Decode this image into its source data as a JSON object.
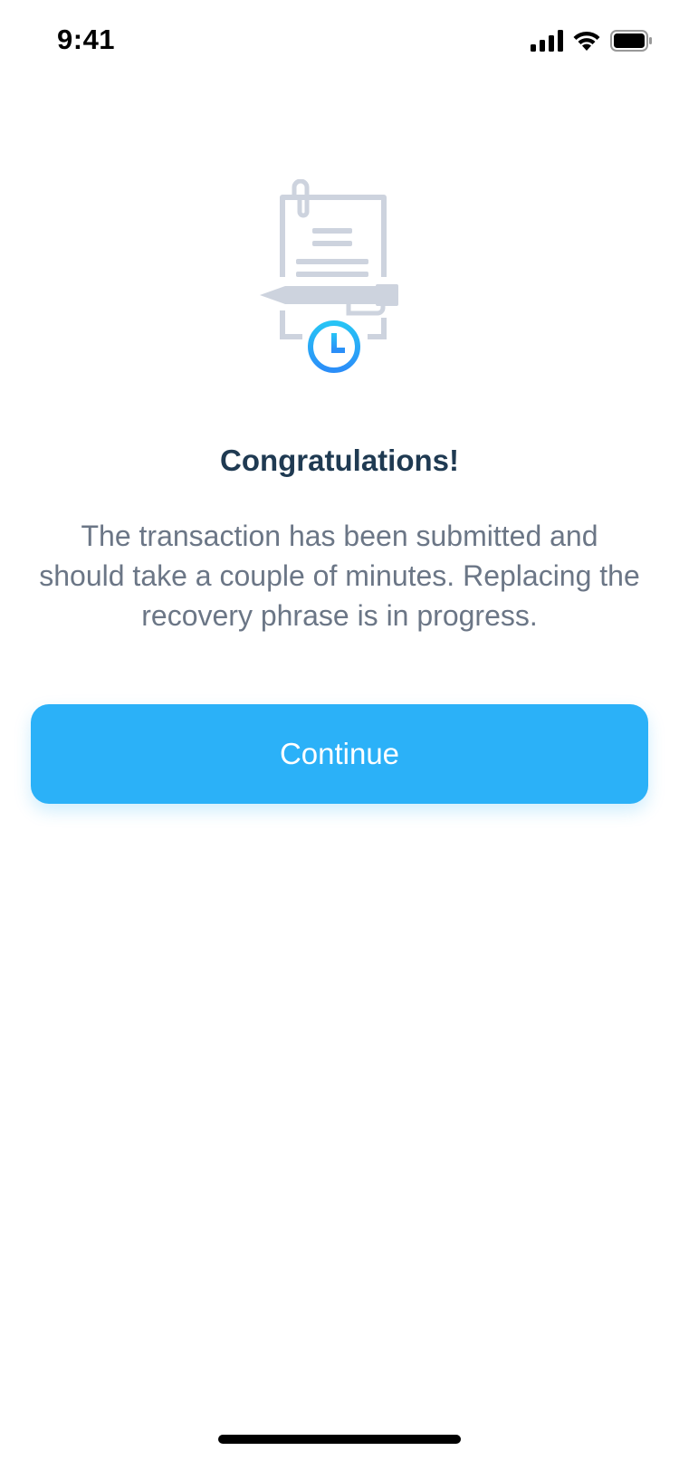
{
  "status_bar": {
    "time": "9:41",
    "icons": [
      "cellular-signal-icon",
      "wifi-icon",
      "battery-icon"
    ]
  },
  "illustration": {
    "icon": "document-pending-clock-icon",
    "line_color": "#cdd3de",
    "clock_gradient": [
      "#27c4f5",
      "#2b8ef8"
    ]
  },
  "content": {
    "title": "Congratulations!",
    "message": "The transaction has been submitted and should take a couple of minutes. Replacing the recovery phrase is in progress."
  },
  "actions": {
    "continue_label": "Continue"
  },
  "colors": {
    "accent": "#2bb1f8",
    "title": "#1f3a52",
    "body_text": "#6b7686",
    "background": "#ffffff"
  }
}
